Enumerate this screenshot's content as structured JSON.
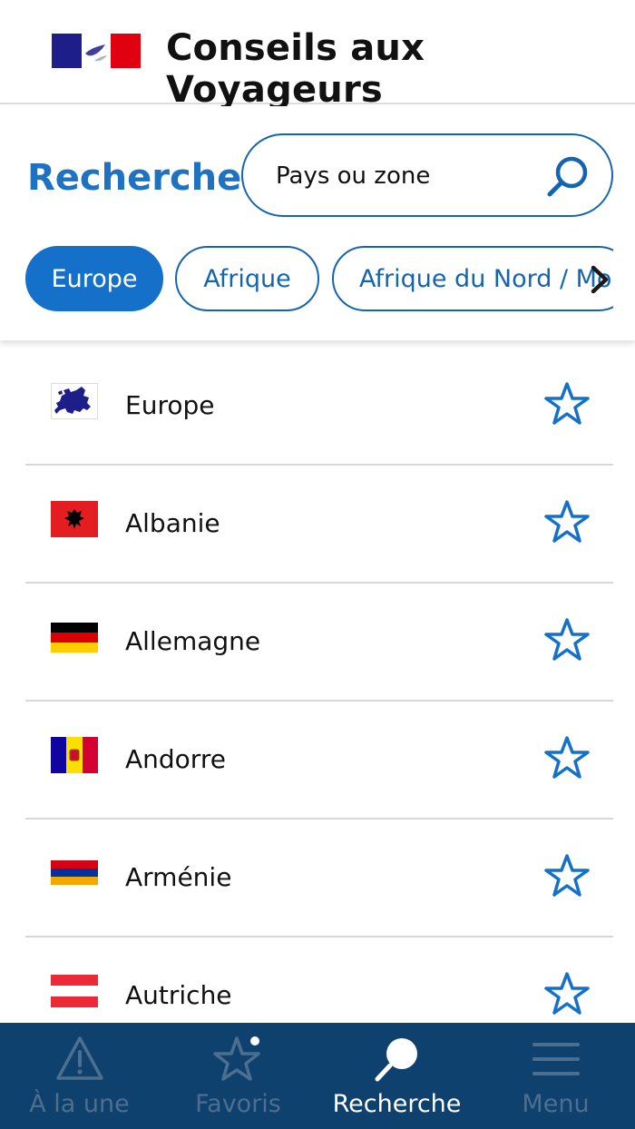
{
  "header": {
    "title": "Conseils aux Voyageurs"
  },
  "search": {
    "heading": "Recherche",
    "placeholder": "Pays ou zone"
  },
  "chips": [
    {
      "label": "Europe",
      "active": true
    },
    {
      "label": "Afrique",
      "active": false
    },
    {
      "label": "Afrique du Nord / Mo",
      "active": false
    }
  ],
  "countries": [
    {
      "name": "Europe",
      "flag": "europe-map-flag"
    },
    {
      "name": "Albanie",
      "flag": "albania-flag"
    },
    {
      "name": "Allemagne",
      "flag": "germany-flag"
    },
    {
      "name": "Andorre",
      "flag": "andorra-flag"
    },
    {
      "name": "Arménie",
      "flag": "armenia-flag"
    },
    {
      "name": "Autriche",
      "flag": "austria-flag"
    }
  ],
  "nav": [
    {
      "label": "À la une",
      "icon": "warning-icon",
      "active": false
    },
    {
      "label": "Favoris",
      "icon": "star-icon",
      "active": false
    },
    {
      "label": "Recherche",
      "icon": "search-icon",
      "active": true
    },
    {
      "label": "Menu",
      "icon": "menu-icon",
      "active": false
    }
  ],
  "colors": {
    "primary": "#1d72c1",
    "chip_active": "#1470c8",
    "nav_background": "#0e416e",
    "nav_inactive": "#4d6f8f"
  }
}
